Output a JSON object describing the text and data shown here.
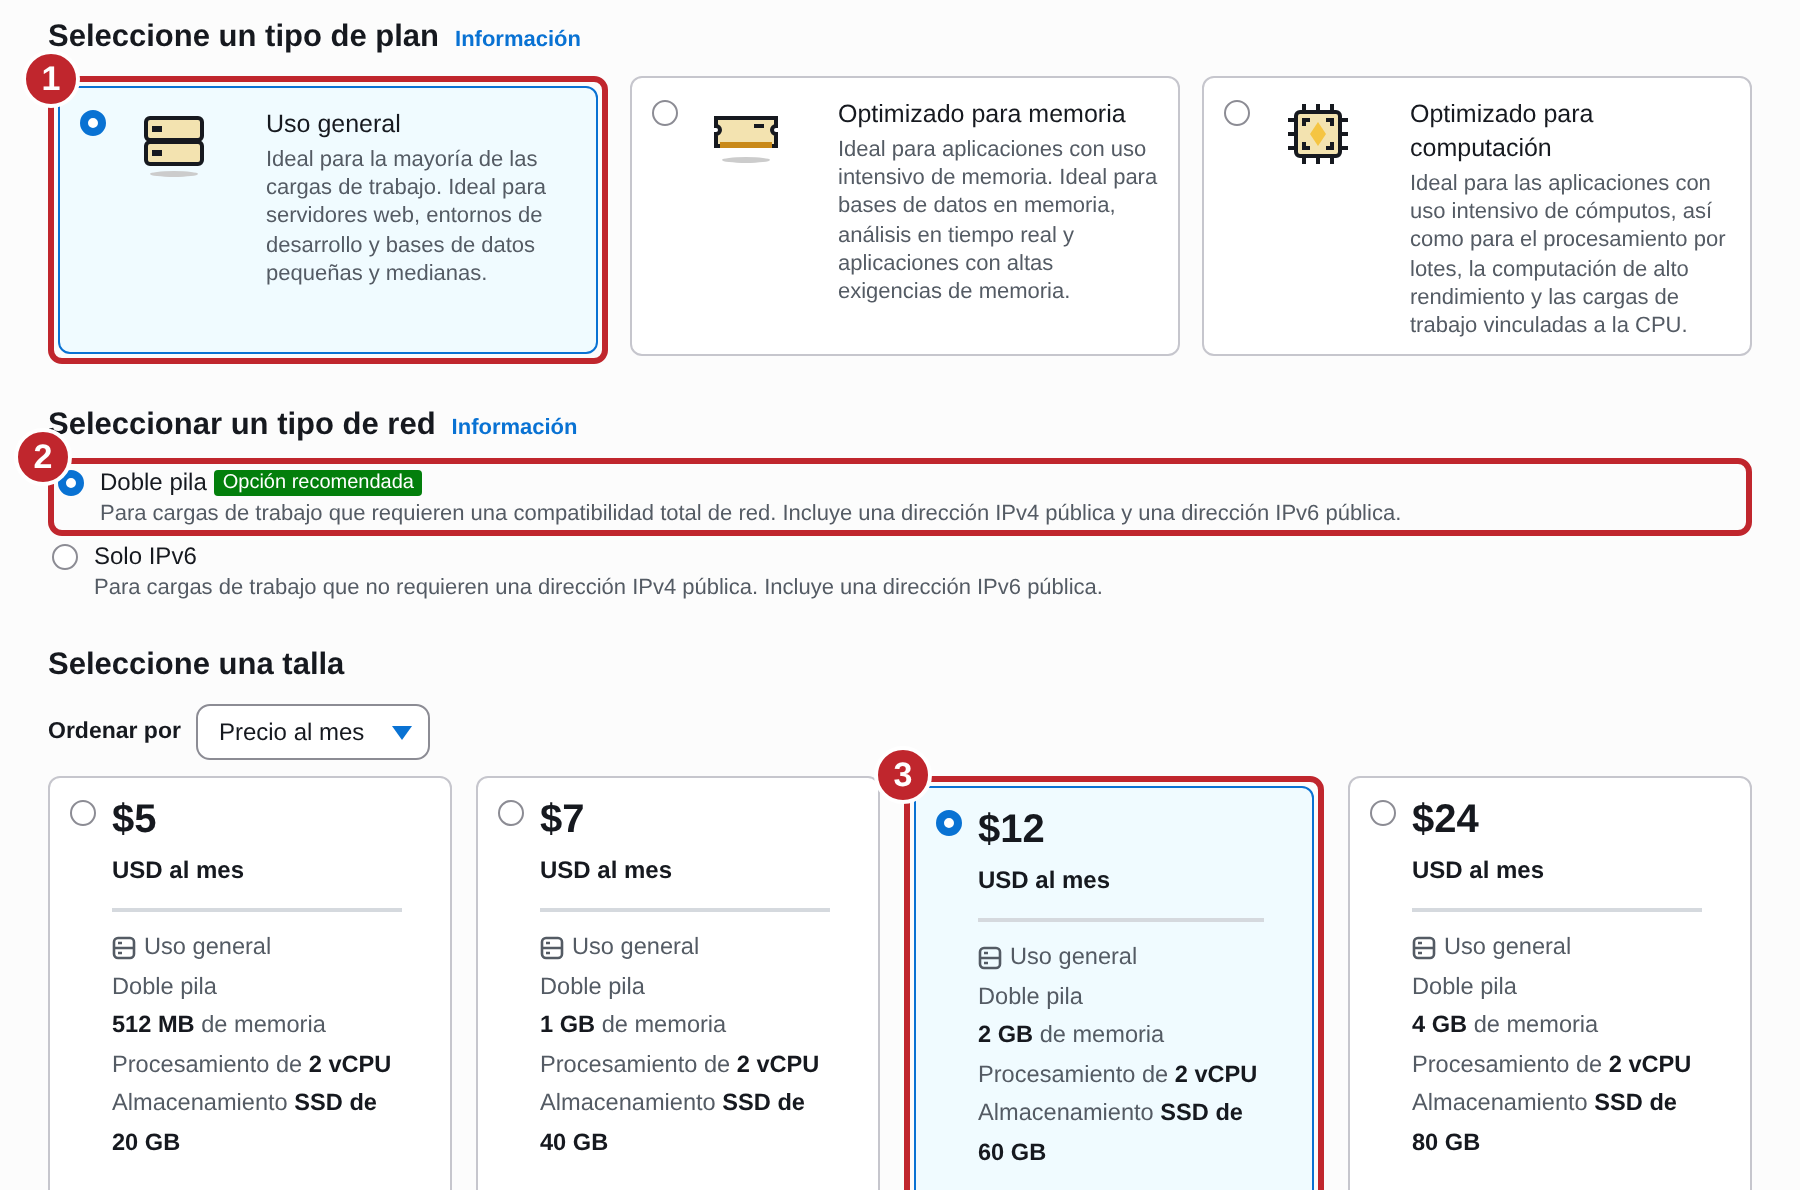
{
  "plan_section": {
    "heading": "Seleccione un tipo de plan",
    "info_link": "Información",
    "options": [
      {
        "kind": "server",
        "title": "Uso general",
        "description": "Ideal para la mayoría de las cargas de trabajo. Ideal para servidores web, entornos de desarrollo y bases de datos pequeñas y medianas.",
        "selected": true,
        "callout": "1"
      },
      {
        "kind": "memory",
        "title": "Optimizado para memoria",
        "description": "Ideal para aplicaciones con uso intensivo de memoria. Ideal para bases de datos en memoria, análisis en tiempo real y aplicaciones con altas exigencias de memoria.",
        "selected": false
      },
      {
        "kind": "cpu",
        "title": "Optimizado para computación",
        "description": "Ideal para las aplicaciones con uso intensivo de cómputos, así como para el procesamiento por lotes, la computación de alto rendimiento y las cargas de trabajo vinculadas a la CPU.",
        "selected": false
      }
    ]
  },
  "network_section": {
    "heading": "Seleccionar un tipo de red",
    "info_link": "Información",
    "options": [
      {
        "label": "Doble pila",
        "badge": "Opción recomendada",
        "description": "Para cargas de trabajo que requieren una compatibilidad total de red. Incluye una dirección IPv4 pública y una dirección IPv6 pública.",
        "selected": true,
        "callout": "2"
      },
      {
        "label": "Solo IPv6",
        "description": "Para cargas de trabajo que no requieren una dirección IPv4 pública. Incluye una dirección IPv6 pública.",
        "selected": false
      }
    ]
  },
  "size_section": {
    "heading": "Seleccione una talla",
    "sort_label": "Ordenar por",
    "sort_value": "Precio al mes",
    "options": [
      {
        "price": "$5",
        "period": "USD al mes",
        "selected": false,
        "specs": [
          {
            "kind": "plan",
            "text": "Uso general"
          },
          {
            "kind": "text",
            "text": "Doble pila"
          },
          {
            "kind": "text",
            "text": "**512 MB** de memoria"
          },
          {
            "kind": "text",
            "text": "Procesamiento de **2 vCPU**"
          },
          {
            "kind": "text",
            "text": "Almacenamiento **SSD de 20 GB**"
          }
        ]
      },
      {
        "price": "$7",
        "period": "USD al mes",
        "selected": false,
        "specs": [
          {
            "kind": "plan",
            "text": "Uso general"
          },
          {
            "kind": "text",
            "text": "Doble pila"
          },
          {
            "kind": "text",
            "text": "**1 GB** de memoria"
          },
          {
            "kind": "text",
            "text": "Procesamiento de **2 vCPU**"
          },
          {
            "kind": "text",
            "text": "Almacenamiento **SSD de 40 GB**"
          }
        ]
      },
      {
        "price": "$12",
        "period": "USD al mes",
        "selected": true,
        "callout": "3",
        "specs": [
          {
            "kind": "plan",
            "text": "Uso general"
          },
          {
            "kind": "text",
            "text": "Doble pila"
          },
          {
            "kind": "text",
            "text": "**2 GB** de memoria"
          },
          {
            "kind": "text",
            "text": "Procesamiento de **2 vCPU**"
          },
          {
            "kind": "text",
            "text": "Almacenamiento **SSD de 60 GB**"
          }
        ]
      },
      {
        "price": "$24",
        "period": "USD al mes",
        "selected": false,
        "specs": [
          {
            "kind": "plan",
            "text": "Uso general"
          },
          {
            "kind": "text",
            "text": "Doble pila"
          },
          {
            "kind": "text",
            "text": "**4 GB** de memoria"
          },
          {
            "kind": "text",
            "text": "Procesamiento de **2 vCPU**"
          },
          {
            "kind": "text",
            "text": "Almacenamiento **SSD de 80 GB**"
          }
        ]
      }
    ]
  }
}
